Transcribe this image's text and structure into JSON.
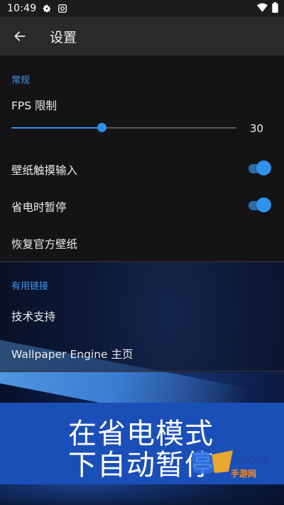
{
  "status_bar": {
    "time": "10:49"
  },
  "app_bar": {
    "title": "设置"
  },
  "general_section": {
    "header": "常规",
    "fps": {
      "label": "FPS 限制",
      "value": "30",
      "fraction": 0.4
    },
    "touch_input": {
      "label": "壁纸触摸输入",
      "enabled": true
    },
    "power_save_pause": {
      "label": "省电时暂停",
      "enabled": true
    },
    "restore_wallpapers": {
      "label": "恢复官方壁纸"
    }
  },
  "links_section": {
    "header": "有用链接",
    "support": {
      "label": "技术支持"
    },
    "homepage": {
      "label": "Wallpaper Engine 主页"
    }
  },
  "promo_banner": {
    "line1": "在省电模式",
    "line2": "下自动暂停"
  },
  "watermark": {
    "brand": ".com",
    "subtitle": "手游网"
  },
  "colors": {
    "accent": "#2f8ee8",
    "section_header": "#3d9bf0",
    "banner": "#1b4fb8"
  }
}
